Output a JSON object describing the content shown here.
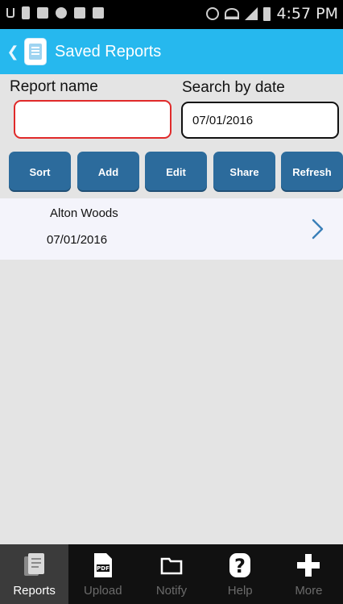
{
  "status_bar": {
    "time": "4:57 PM",
    "left_icons": [
      "usb-icon",
      "battery-saver-icon",
      "image-icon",
      "chat-icon",
      "gmail-icon",
      "message-icon"
    ],
    "right_icons": [
      "alarm-icon",
      "wifi-icon",
      "signal-icon",
      "battery-icon"
    ]
  },
  "app_bar": {
    "title": "Saved Reports",
    "back_icon": "chevron-left-icon",
    "app_icon": "report-app-icon",
    "background": "#26b8ee"
  },
  "form": {
    "report_name_label": "Report name",
    "report_name_value": "",
    "search_date_label": "Search by date",
    "search_date_value": "07/01/2016"
  },
  "actions": {
    "sort": "Sort",
    "add": "Add",
    "edit": "Edit",
    "share": "Share",
    "refresh": "Refresh",
    "color": "#2c6b9c"
  },
  "reports": [
    {
      "name": "Alton Woods",
      "date": "07/01/2016"
    }
  ],
  "bottom_nav": {
    "active": "Reports",
    "tabs": [
      {
        "label": "Reports",
        "icon": "reports-icon"
      },
      {
        "label": "Upload",
        "icon": "pdf-icon"
      },
      {
        "label": "Notify",
        "icon": "folder-icon"
      },
      {
        "label": "Help",
        "icon": "help-icon"
      },
      {
        "label": "More",
        "icon": "plus-icon"
      }
    ]
  }
}
